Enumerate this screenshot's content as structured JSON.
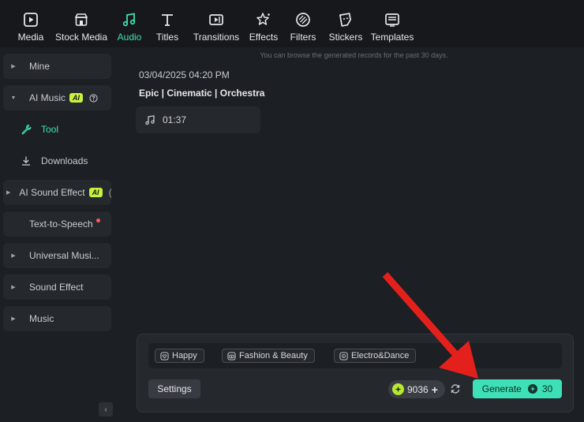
{
  "toolbar": {
    "items": [
      {
        "label": "Media",
        "icon": "media-icon"
      },
      {
        "label": "Stock Media",
        "icon": "stock-media-icon"
      },
      {
        "label": "Audio",
        "icon": "audio-icon",
        "active": true
      },
      {
        "label": "Titles",
        "icon": "titles-icon"
      },
      {
        "label": "Transitions",
        "icon": "transitions-icon"
      },
      {
        "label": "Effects",
        "icon": "effects-icon"
      },
      {
        "label": "Filters",
        "icon": "filters-icon"
      },
      {
        "label": "Stickers",
        "icon": "stickers-icon"
      },
      {
        "label": "Templates",
        "icon": "templates-icon"
      }
    ]
  },
  "sidebar": {
    "mine": "Mine",
    "ai_music": "AI Music",
    "ai_badge": "AI",
    "tool": "Tool",
    "downloads": "Downloads",
    "ai_sound_effect": "AI Sound Effect",
    "ai_sound_badge": "AI",
    "ai_sound_trunc": "(",
    "text_to_speech": "Text-to-Speech",
    "universal_music": "Universal Musi...",
    "sound_effect": "Sound Effect",
    "music": "Music",
    "collapse": "‹"
  },
  "main": {
    "notice": "You can browse the generated records for the past 30 days.",
    "record": {
      "date": "03/04/2025 04:20 PM",
      "title": "Epic | Cinematic | Orchestra",
      "duration": "01:37"
    }
  },
  "panel": {
    "tags": [
      "Happy",
      "Fashion & Beauty",
      "Electro&Dance"
    ],
    "settings": "Settings",
    "credits": "9036",
    "credits_plus": "+",
    "generate": "Generate",
    "generate_cost": "30"
  },
  "colors": {
    "accent": "#3ee0b7",
    "ai_badge": "#c8f23b",
    "arrow": "#e3201b"
  }
}
